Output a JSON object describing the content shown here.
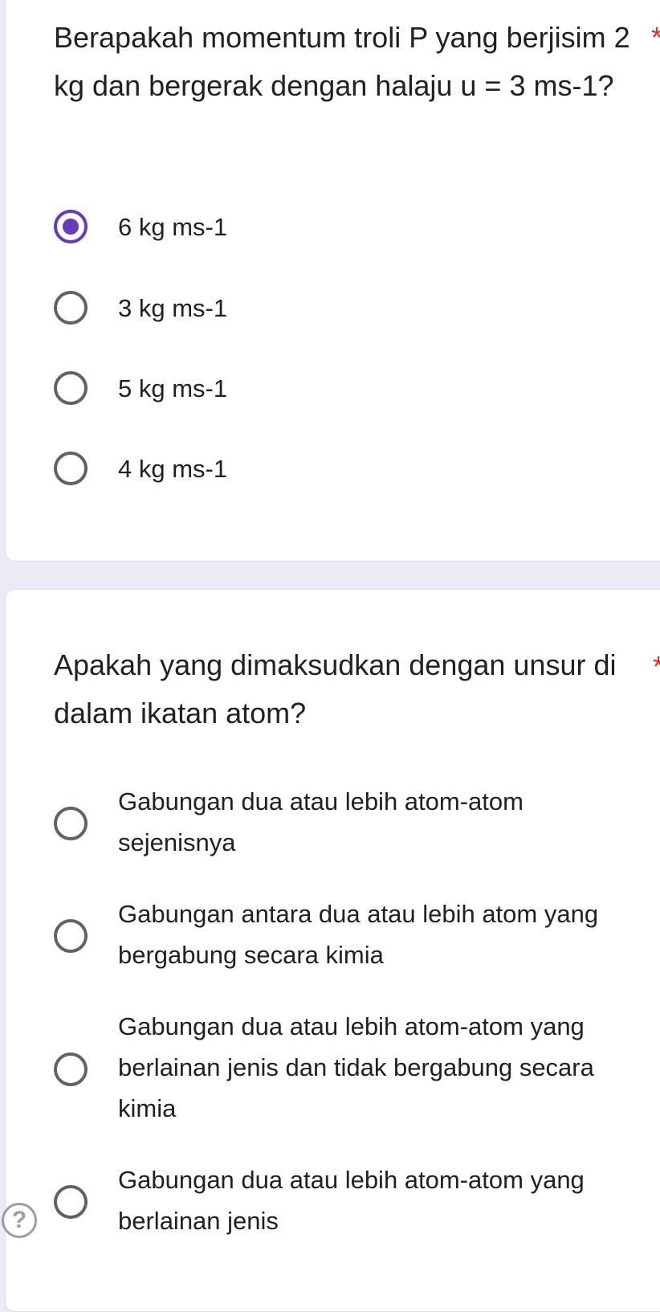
{
  "questions": [
    {
      "text": "Berapakah momentum troli P yang berjisim 2 kg dan bergerak dengan halaju u = 3 ms-1?",
      "required_mark": "*",
      "options": [
        {
          "label": "6 kg ms-1",
          "selected": true
        },
        {
          "label": "3 kg ms-1",
          "selected": false
        },
        {
          "label": "5 kg ms-1",
          "selected": false
        },
        {
          "label": "4 kg ms-1",
          "selected": false
        }
      ]
    },
    {
      "text": "Apakah yang dimaksudkan dengan unsur di dalam ikatan atom?",
      "required_mark": "*",
      "options": [
        {
          "label": "Gabungan dua atau lebih atom-atom sejenisnya",
          "selected": false
        },
        {
          "label": "Gabungan antara dua atau lebih atom yang bergabung secara kimia",
          "selected": false
        },
        {
          "label": "Gabungan dua atau lebih atom-atom yang berlainan jenis dan tidak bergabung secara kimia",
          "selected": false
        },
        {
          "label": "Gabungan dua atau lebih atom-atom yang berlainan jenis",
          "selected": false
        }
      ]
    }
  ],
  "help": {
    "glyph": "?"
  },
  "colors": {
    "accent": "#673ab7",
    "page_background": "#ede9f7",
    "required": "#d93025"
  },
  "icons": {
    "radio_selected": "radio-checked-icon",
    "radio_unselected": "radio-unchecked-icon",
    "help": "help-circle-icon"
  }
}
